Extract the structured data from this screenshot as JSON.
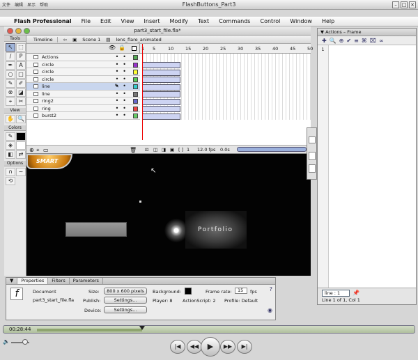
{
  "window": {
    "title": "FlashButtons_Part3",
    "cjk_menu": [
      "文件",
      "编辑",
      "显示",
      "帮助"
    ]
  },
  "menubar": {
    "app": "Flash Professional",
    "items": [
      "File",
      "Edit",
      "View",
      "Insert",
      "Modify",
      "Text",
      "Commands",
      "Control",
      "Window",
      "Help"
    ]
  },
  "document": {
    "title": "part3_start_file.fla*"
  },
  "tools": {
    "label": "Tools",
    "view_label": "View",
    "colors_label": "Colors",
    "options_label": "Options",
    "glyphs": [
      "↖",
      "⬚",
      "∕",
      "P",
      "✒",
      "A",
      "○",
      "□",
      "✎",
      "✐",
      "⊗",
      "◪",
      "⌖",
      "✂"
    ]
  },
  "timeline": {
    "tab": "Timeline",
    "scene": "Scene 1",
    "symbol": "lens_flare_animated",
    "ruler": [
      "1",
      "5",
      "10",
      "15",
      "20",
      "25",
      "30",
      "35",
      "40",
      "45",
      "50"
    ],
    "layers": [
      {
        "name": "Actions",
        "color": "#55aa55"
      },
      {
        "name": "circle",
        "color": "#9933cc"
      },
      {
        "name": "circle",
        "color": "#ffff33"
      },
      {
        "name": "circle",
        "color": "#55cc55"
      },
      {
        "name": "line",
        "color": "#33cccc"
      },
      {
        "name": "line",
        "color": "#777777"
      },
      {
        "name": "ring2",
        "color": "#6666cc"
      },
      {
        "name": "ring",
        "color": "#ee4444"
      },
      {
        "name": "burst2",
        "color": "#66cc66"
      }
    ],
    "frame": "1",
    "fps": "12.0 fps",
    "time": "0.0s"
  },
  "stage": {
    "logo_text": "SMART",
    "button_text": "Portfolio"
  },
  "actions": {
    "title": "Actions – Frame",
    "line_number": "1",
    "tab": "line : 1",
    "status": "Line 1 of 1, Col 1"
  },
  "properties": {
    "tabs": [
      "Properties",
      "Filters",
      "Parameters"
    ],
    "doc_label": "Document",
    "file_name": "part3_start_file.fla",
    "size_label": "Size:",
    "size_value": "800 x 600 pixels",
    "background_label": "Background:",
    "framerate_label": "Frame rate:",
    "framerate_value": "15",
    "fps_unit": "fps",
    "publish_label": "Publish:",
    "settings": "Settings...",
    "player": "Player: 8",
    "actionscript": "ActionScript: 2",
    "profile": "Profile: Default",
    "device_label": "Device:"
  },
  "player": {
    "time": "00:28:44",
    "progress": 0.36
  }
}
